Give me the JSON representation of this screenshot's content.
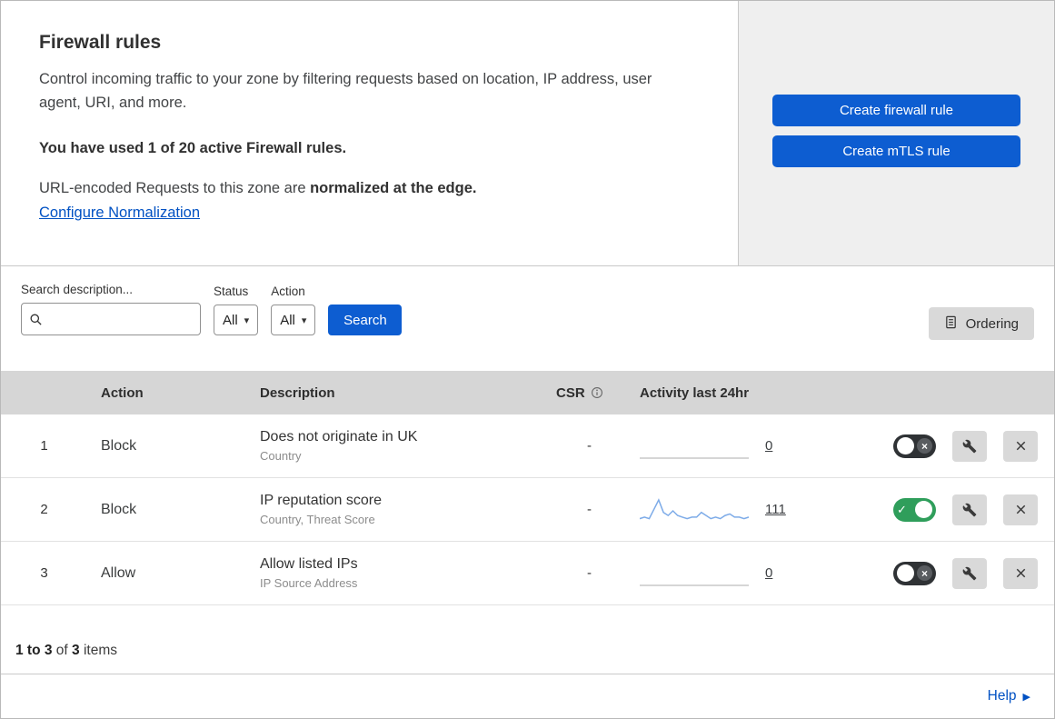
{
  "colors": {
    "accent_blue": "#0d5dd1",
    "link_blue": "#0051c3",
    "toggle_green": "#2f9e5b",
    "toggle_off": "#2f3235",
    "sparkline_blue": "#7dabe8",
    "sparkline_gray": "#c9c9c9"
  },
  "header": {
    "title": "Firewall rules",
    "description": "Control incoming traffic to your zone by filtering requests based on location, IP address, user agent, URI, and more.",
    "usage": "You have used 1 of 20 active Firewall rules.",
    "normalization_prefix": "URL-encoded Requests to this zone are ",
    "normalization_bold": "normalized at the edge.",
    "configure_link": "Configure Normalization",
    "create_firewall_button": "Create firewall rule",
    "create_mtls_button": "Create mTLS rule"
  },
  "filters": {
    "search_label": "Search description...",
    "status_label": "Status",
    "status_value": "All",
    "action_label": "Action",
    "action_value": "All",
    "search_button": "Search",
    "ordering_button": "Ordering"
  },
  "table": {
    "headers": {
      "action": "Action",
      "description": "Description",
      "csr": "CSR",
      "activity": "Activity last 24hr"
    },
    "rows": [
      {
        "priority": "1",
        "action": "Block",
        "description": "Does not originate in UK",
        "fields": "Country",
        "csr": "-",
        "activity_count": "0",
        "enabled": false,
        "sparkline": [
          0,
          0,
          0,
          0,
          0,
          0,
          0,
          0,
          0,
          0,
          0,
          0,
          0,
          0,
          0,
          0,
          0,
          0,
          0,
          0,
          0,
          0,
          0,
          0
        ]
      },
      {
        "priority": "2",
        "action": "Block",
        "description": "IP reputation score",
        "fields": "Country, Threat Score",
        "csr": "-",
        "activity_count": "111",
        "enabled": true,
        "sparkline": [
          2,
          3,
          2,
          8,
          14,
          6,
          4,
          7,
          4,
          3,
          2,
          3,
          3,
          6,
          4,
          2,
          3,
          2,
          4,
          5,
          3,
          3,
          2,
          3
        ]
      },
      {
        "priority": "3",
        "action": "Allow",
        "description": "Allow listed IPs",
        "fields": "IP Source Address",
        "csr": "-",
        "activity_count": "0",
        "enabled": false,
        "sparkline": [
          0,
          0,
          0,
          0,
          0,
          0,
          0,
          0,
          0,
          0,
          0,
          0,
          0,
          0,
          0,
          0,
          0,
          0,
          0,
          0,
          0,
          0,
          0,
          0
        ]
      }
    ]
  },
  "footer": {
    "range": "1 to 3",
    "of": "of",
    "total": "3",
    "items": "items"
  },
  "help": {
    "label": "Help"
  }
}
